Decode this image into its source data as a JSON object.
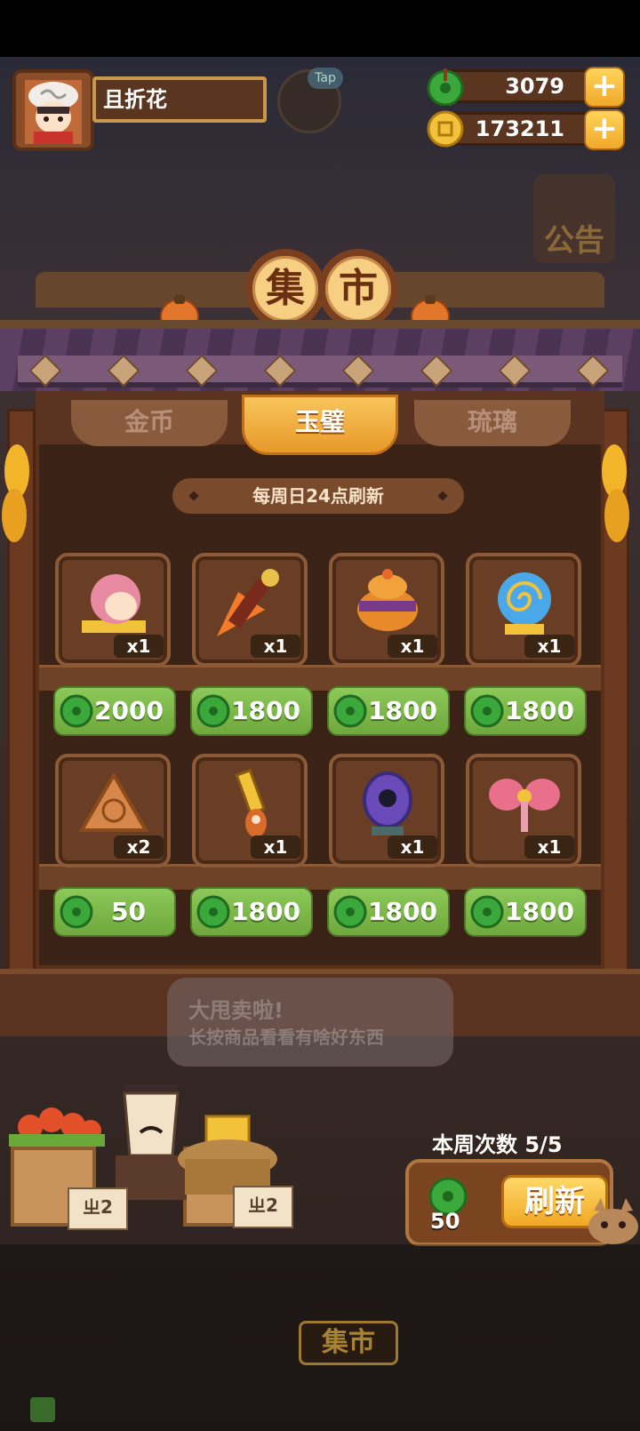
{
  "player": {
    "name": "且折花"
  },
  "tap_label": "Tap",
  "currencies": {
    "jade": "3079",
    "gold": "173211",
    "plus": "+"
  },
  "side_notice": "公告",
  "market_sign": [
    "集",
    "市"
  ],
  "tabs": [
    {
      "label": "金币",
      "active": false
    },
    {
      "label": "玉璧",
      "active": true
    },
    {
      "label": "琉璃",
      "active": false
    }
  ],
  "refresh_note": "每周日24点刷新",
  "items": [
    {
      "name": "character-fragment",
      "qty": "x1",
      "price": "2000"
    },
    {
      "name": "brush-item",
      "qty": "x1",
      "price": "1800"
    },
    {
      "name": "incense-burner",
      "qty": "x1",
      "price": "1800"
    },
    {
      "name": "blue-conch",
      "qty": "x1",
      "price": "1800"
    },
    {
      "name": "rice-dumpling",
      "qty": "x2",
      "price": "50"
    },
    {
      "name": "golden-key",
      "qty": "x1",
      "price": "1800"
    },
    {
      "name": "purple-lantern",
      "qty": "x1",
      "price": "1800"
    },
    {
      "name": "pink-bow",
      "qty": "x1",
      "price": "1800"
    }
  ],
  "speech": {
    "line1": "大甩卖啦!",
    "line2": "长按商品看看有啥好东西"
  },
  "price_tags": [
    "ㄓ2",
    "ㄓ2"
  ],
  "weekly": "本周次数  5/5",
  "refresh": {
    "cost": "50",
    "label": "刷新"
  },
  "bottom_sign": "集市",
  "colors": {
    "jade_green": "#6fa83c",
    "gold_btn": "#f0a82a",
    "wood": "#6a3e24"
  }
}
